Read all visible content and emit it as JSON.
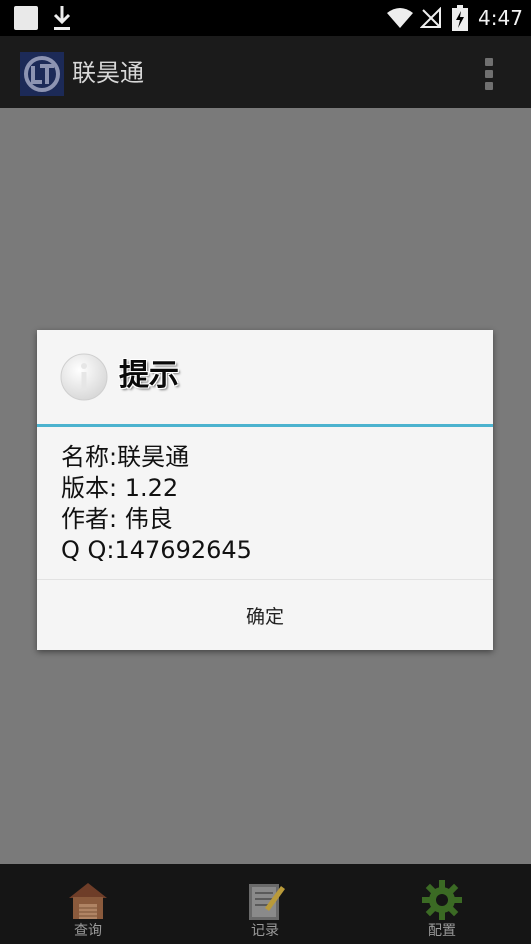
{
  "status_bar": {
    "time": "4:47",
    "icons": [
      "notification-square-icon",
      "download-icon",
      "wifi-icon",
      "no-signal-icon",
      "battery-charging-icon"
    ]
  },
  "app_bar": {
    "title": "联昊通",
    "logo_icon": "app-logo-icon",
    "menu_icon": "overflow-menu-icon"
  },
  "dialog": {
    "title": "提示",
    "icon": "info-icon",
    "lines": [
      "名称:联昊通",
      "版本: 1.22",
      "作者: 伟良",
      "Q Q:147692645"
    ],
    "ok_label": "确定"
  },
  "tabs": [
    {
      "label": "查询",
      "icon": "house-icon"
    },
    {
      "label": "记录",
      "icon": "notepad-icon"
    },
    {
      "label": "配置",
      "icon": "gear-icon"
    }
  ],
  "colors": {
    "divider_accent": "#4cb3cf",
    "scrim": "#7a7a7a",
    "dialog_bg": "#f5f5f5"
  }
}
